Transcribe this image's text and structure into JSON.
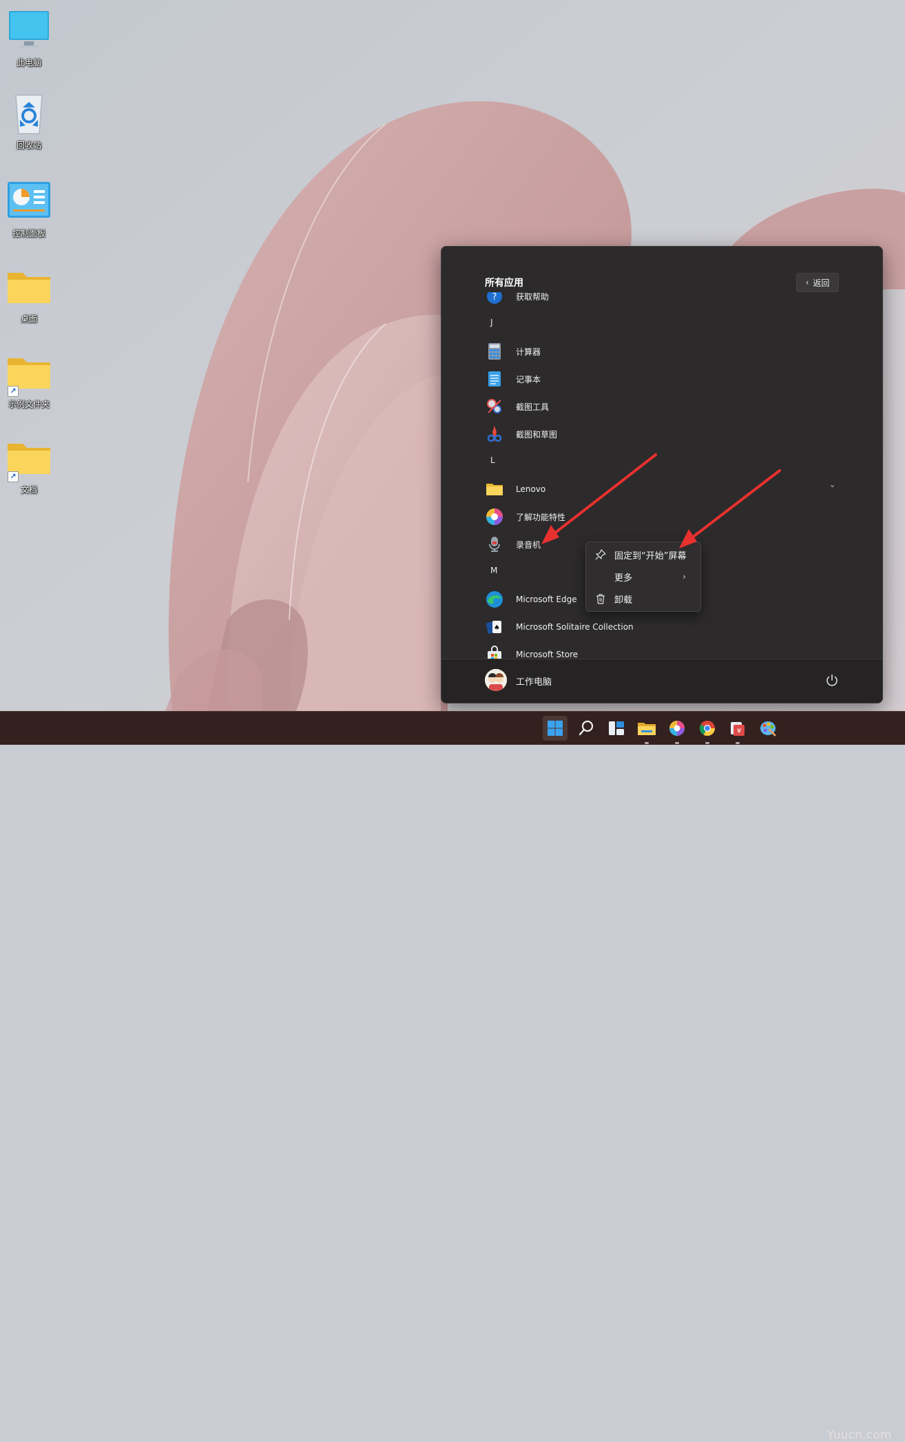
{
  "desktop": {
    "icons": [
      {
        "label": "此电脑"
      },
      {
        "label": "回收站"
      },
      {
        "label": "控制面板"
      },
      {
        "label": "桌面"
      },
      {
        "label": "示例文件夹"
      },
      {
        "label": "文档"
      }
    ]
  },
  "start_menu": {
    "title": "所有应用",
    "back_label": "返回",
    "partial_item": "获取帮助",
    "apps": [
      {
        "type": "letter",
        "label": "J"
      },
      {
        "type": "app",
        "label": "计算器",
        "icon": "calculator-icon"
      },
      {
        "type": "app",
        "label": "记事本",
        "icon": "notepad-icon"
      },
      {
        "type": "app",
        "label": "截图工具",
        "icon": "snipping-tool-icon"
      },
      {
        "type": "app",
        "label": "截图和草图",
        "icon": "snip-sketch-icon"
      },
      {
        "type": "letter",
        "label": "L"
      },
      {
        "type": "app",
        "label": "Lenovo",
        "icon": "folder-icon"
      },
      {
        "type": "app",
        "label": "了解功能特性",
        "icon": "tips-icon"
      },
      {
        "type": "app",
        "label": "录音机",
        "icon": "voice-recorder-icon"
      },
      {
        "type": "letter",
        "label": "M"
      },
      {
        "type": "app",
        "label": "Microsoft Edge",
        "icon": "edge-icon"
      },
      {
        "type": "app",
        "label": "Microsoft Solitaire Collection",
        "icon": "solitaire-icon"
      },
      {
        "type": "app",
        "label": "Microsoft Store",
        "icon": "store-icon"
      }
    ],
    "user": {
      "name": "工作电脑"
    }
  },
  "context_menu": {
    "items": [
      {
        "label": "固定到“开始”屏幕",
        "icon": "pin-icon"
      },
      {
        "label": "更多",
        "icon": "none"
      },
      {
        "label": "卸载",
        "icon": "trash-icon"
      }
    ]
  },
  "taskbar": {
    "items": [
      "start-icon",
      "search-icon",
      "widgets-icon",
      "file-explorer-icon",
      "tips-icon",
      "chrome-icon",
      "wps-icon",
      "paint-icon"
    ]
  },
  "watermark": "Yuucn.com",
  "colors": {
    "annotation": "#e8312f",
    "menu_bg": "#2c2a2a",
    "accent": "#2b8de8"
  }
}
